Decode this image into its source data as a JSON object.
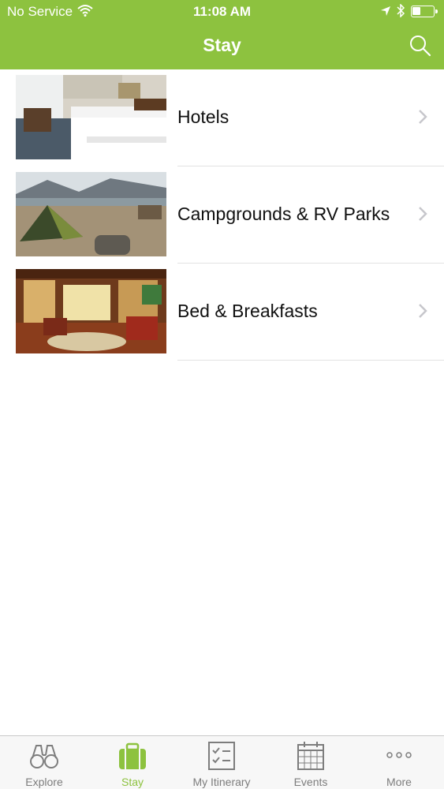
{
  "status_bar": {
    "carrier": "No Service",
    "time": "11:08 AM"
  },
  "nav": {
    "title": "Stay",
    "search_icon": "search-icon"
  },
  "categories": [
    {
      "label": "Hotels",
      "image": "hotel-room-photo"
    },
    {
      "label": "Campgrounds & RV Parks",
      "image": "campground-tent-photo"
    },
    {
      "label": "Bed & Breakfasts",
      "image": "victorian-parlor-photo"
    }
  ],
  "tabs": [
    {
      "label": "Explore",
      "icon": "binoculars-icon",
      "active": false
    },
    {
      "label": "Stay",
      "icon": "suitcase-icon",
      "active": true
    },
    {
      "label": "My Itinerary",
      "icon": "checklist-icon",
      "active": false
    },
    {
      "label": "Events",
      "icon": "calendar-icon",
      "active": false
    },
    {
      "label": "More",
      "icon": "more-dots-icon",
      "active": false
    }
  ],
  "colors": {
    "accent": "#8dc23f",
    "tab_inactive": "#7d7d7d",
    "separator": "#e3e3e3"
  }
}
